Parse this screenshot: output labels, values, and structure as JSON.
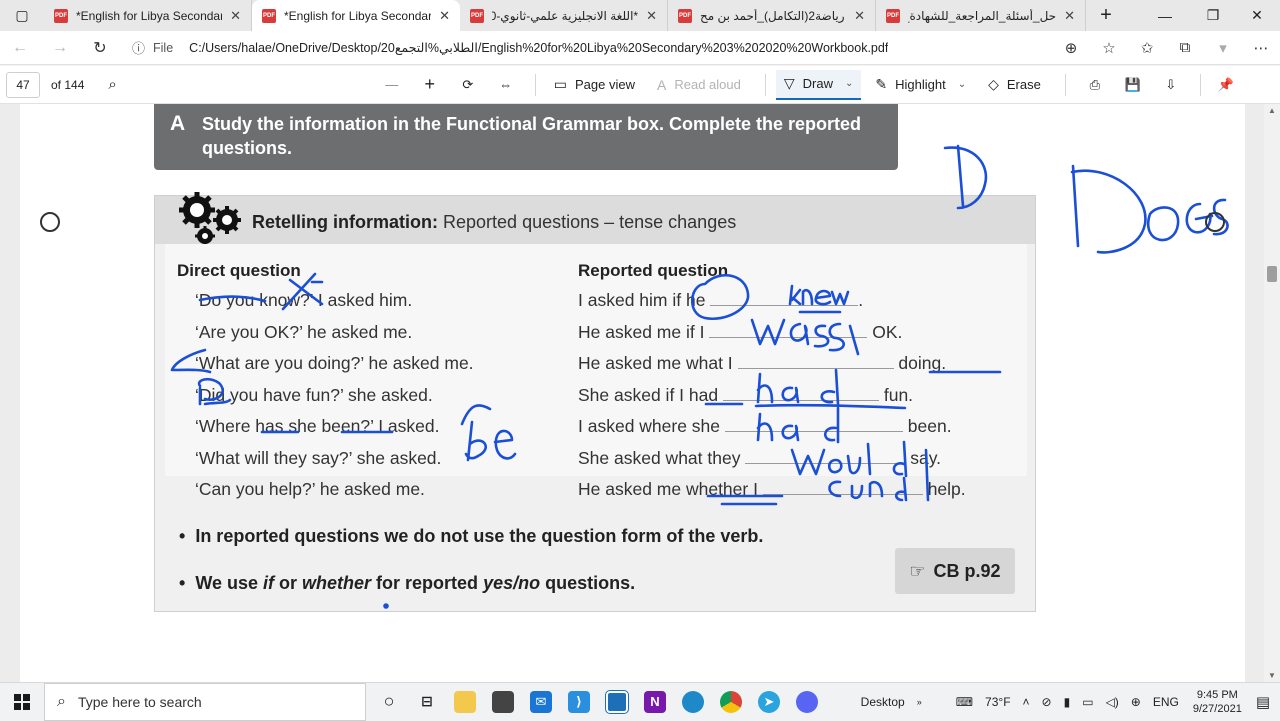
{
  "tabs": [
    {
      "title": "*English for Libya Secondary",
      "active": false
    },
    {
      "title": "*English for Libya Secondary",
      "active": true
    },
    {
      "title": "*اللغة الانجليزية علمي-ثانوي-0",
      "active": false
    },
    {
      "title": "رياضة2(التكامل)_أحمد بن مح",
      "active": false
    },
    {
      "title": "حل_أسئلة_المراجعة_للشهادة_ال",
      "active": false
    }
  ],
  "address": {
    "file_label": "File",
    "url": "C:/Users/halae/OneDrive/Desktop/الطلابي%التجمع20/English%20for%20Libya%20Secondary%203%202020%20Workbook.pdf"
  },
  "pdf_toolbar": {
    "page": "47",
    "of_pages": "of 144",
    "page_view": "Page view",
    "read_aloud": "Read aloud",
    "draw": "Draw",
    "highlight": "Highlight",
    "erase": "Erase"
  },
  "doc": {
    "banner_letter": "A",
    "banner_text": "Study the information in the Functional Grammar box. Complete the reported questions.",
    "box_title_bold": "Retelling information:",
    "box_title_rest": "Reported questions – tense changes",
    "col_direct": "Direct question",
    "col_reported": "Reported question",
    "direct": [
      "‘Do you know?’ I asked him.",
      "‘Are you OK?’ he asked me.",
      "‘What are you doing?’ he asked me.",
      "‘Did you have fun?’ she asked.",
      "‘Where has she been?’ I asked.",
      "‘What will they say?’ she asked.",
      "‘Can you help?’ he asked me."
    ],
    "reported": [
      {
        "pre": "I asked him if he",
        "post": "."
      },
      {
        "pre": "He asked me if I",
        "post": "OK."
      },
      {
        "pre": "He asked me what I",
        "post": "doing."
      },
      {
        "pre": "She asked if I had",
        "post": "fun."
      },
      {
        "pre": "I asked where she",
        "post": "been."
      },
      {
        "pre": "She asked what they",
        "post": "say."
      },
      {
        "pre": "He asked me whether I",
        "post": "help."
      }
    ],
    "bullet1": "In reported questions we do not use the question form of the verb.",
    "bullet2_a": "We use ",
    "bullet2_if": "if",
    "bullet2_or": " or ",
    "bullet2_whether": "whether",
    "bullet2_b": " for reported ",
    "bullet2_yesno": "yes/no",
    "bullet2_c": " questions.",
    "cb_ref": "CB p.92"
  },
  "taskbar": {
    "search_placeholder": "Type here to search",
    "desktop_label": "Desktop",
    "weather": "73°F",
    "lang": "ENG",
    "time": "9:45 PM",
    "date": "9/27/2021"
  },
  "colors": {
    "ink": "#1a4fd6",
    "banner": "#6d6e70",
    "accent": "#0f6cbd"
  }
}
